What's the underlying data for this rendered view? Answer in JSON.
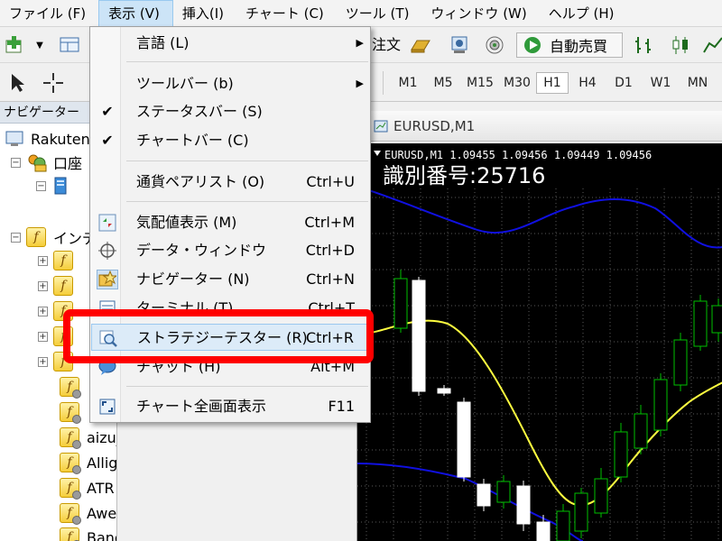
{
  "menubar": {
    "items": [
      {
        "label": "ファイル (F)"
      },
      {
        "label": "表示 (V)"
      },
      {
        "label": "挿入(I)"
      },
      {
        "label": "チャート (C)"
      },
      {
        "label": "ツール (T)"
      },
      {
        "label": "ウィンドウ (W)"
      },
      {
        "label": "ヘルプ (H)"
      }
    ]
  },
  "toolbar": {
    "order_label": "注文",
    "auto_trade_label": "自動売買",
    "timeframes": [
      "M1",
      "M5",
      "M15",
      "M30",
      "H1",
      "H4",
      "D1",
      "W1",
      "MN"
    ],
    "selected_timeframe": "H1"
  },
  "navigator": {
    "title": "ナビゲーター",
    "close": "×",
    "tree": {
      "root": "Rakuten",
      "accounts": "口座",
      "indicators": "インディケータ",
      "items": [
        "aizu_test",
        "Alligator",
        "ATR",
        "Awesome",
        "Bands"
      ]
    }
  },
  "chart": {
    "window_title": "EURUSD,M1",
    "info_line": "EURUSD,M1  1.09455 1.09456 1.09449 1.09456",
    "overlay_text": "識別番号:25716",
    "colors": {
      "background": "#000000",
      "bull": "#00c000",
      "bear": "#ffffff",
      "upper_band": "#1010e0",
      "lower_band": "#1010e0",
      "ma": "#ffff40",
      "grid": "#5a5a5a"
    }
  },
  "view_menu": {
    "items": [
      {
        "label": "言語 (L)",
        "shortcut": "",
        "has_submenu": true
      },
      {
        "label": "ツールバー (b)",
        "shortcut": "",
        "has_submenu": true
      },
      {
        "label": "ステータスバー (S)",
        "shortcut": "",
        "checked": true
      },
      {
        "label": "チャートバー (C)",
        "shortcut": "",
        "checked": true
      },
      {
        "label": "通貨ペアリスト (O)",
        "shortcut": "Ctrl+U"
      },
      {
        "label": "気配値表示 (M)",
        "shortcut": "Ctrl+M",
        "icon": "quotes-icon"
      },
      {
        "label": "データ・ウィンドウ",
        "shortcut": "Ctrl+D",
        "icon": "crosshair-icon"
      },
      {
        "label": "ナビゲーター (N)",
        "shortcut": "Ctrl+N",
        "icon": "navigator-icon"
      },
      {
        "label": "ターミナル (T)",
        "shortcut": "Ctrl+T",
        "icon": "terminal-icon"
      },
      {
        "label": "ストラテジーテスター (R)",
        "shortcut": "Ctrl+R",
        "icon": "strategy-tester-icon",
        "highlighted": true
      },
      {
        "label": "チャット (H)",
        "shortcut": "Alt+M",
        "icon": "chat-icon"
      },
      {
        "label": "チャート全画面表示",
        "shortcut": "F11",
        "icon": "fullscreen-icon"
      }
    ],
    "check_mark": "✔",
    "submenu_arrow": "▶"
  },
  "annotation": {
    "color": "#ff0000"
  }
}
